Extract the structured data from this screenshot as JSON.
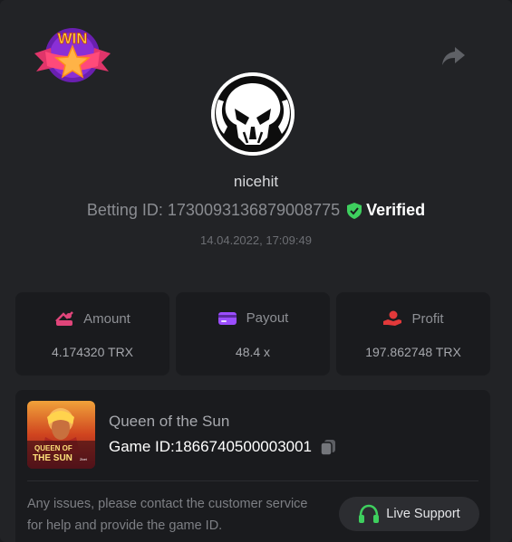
{
  "header": {
    "badge_text": "WIN",
    "share_icon": "share-icon"
  },
  "profile": {
    "username": "nicehit",
    "betting_id_label": "Betting ID: 1730093136879008775",
    "verified_label": "Verified",
    "timestamp": "14.04.2022, 17:09:49"
  },
  "stats": [
    {
      "label": "Amount",
      "value": "4.174320 TRX",
      "icon": "amount-icon",
      "color": "#e0457a"
    },
    {
      "label": "Payout",
      "value": "48.4 x",
      "icon": "payout-icon",
      "color": "#9b4dff"
    },
    {
      "label": "Profit",
      "value": "197.862748 TRX",
      "icon": "profit-icon",
      "color": "#e2393a"
    }
  ],
  "game": {
    "title": "Queen of the Sun",
    "game_id_label": "Game ID:1866740500003001",
    "thumb_text_1": "QUEEN OF",
    "thumb_text_2": "THE SUN",
    "thumb_text_3": "2bet"
  },
  "support": {
    "issues_text": "Any issues, please contact the customer service for help and provide the game ID.",
    "live_support_label": "Live Support"
  },
  "colors": {
    "verified_green": "#3ecf5e",
    "headset_green": "#3ecf5e"
  }
}
